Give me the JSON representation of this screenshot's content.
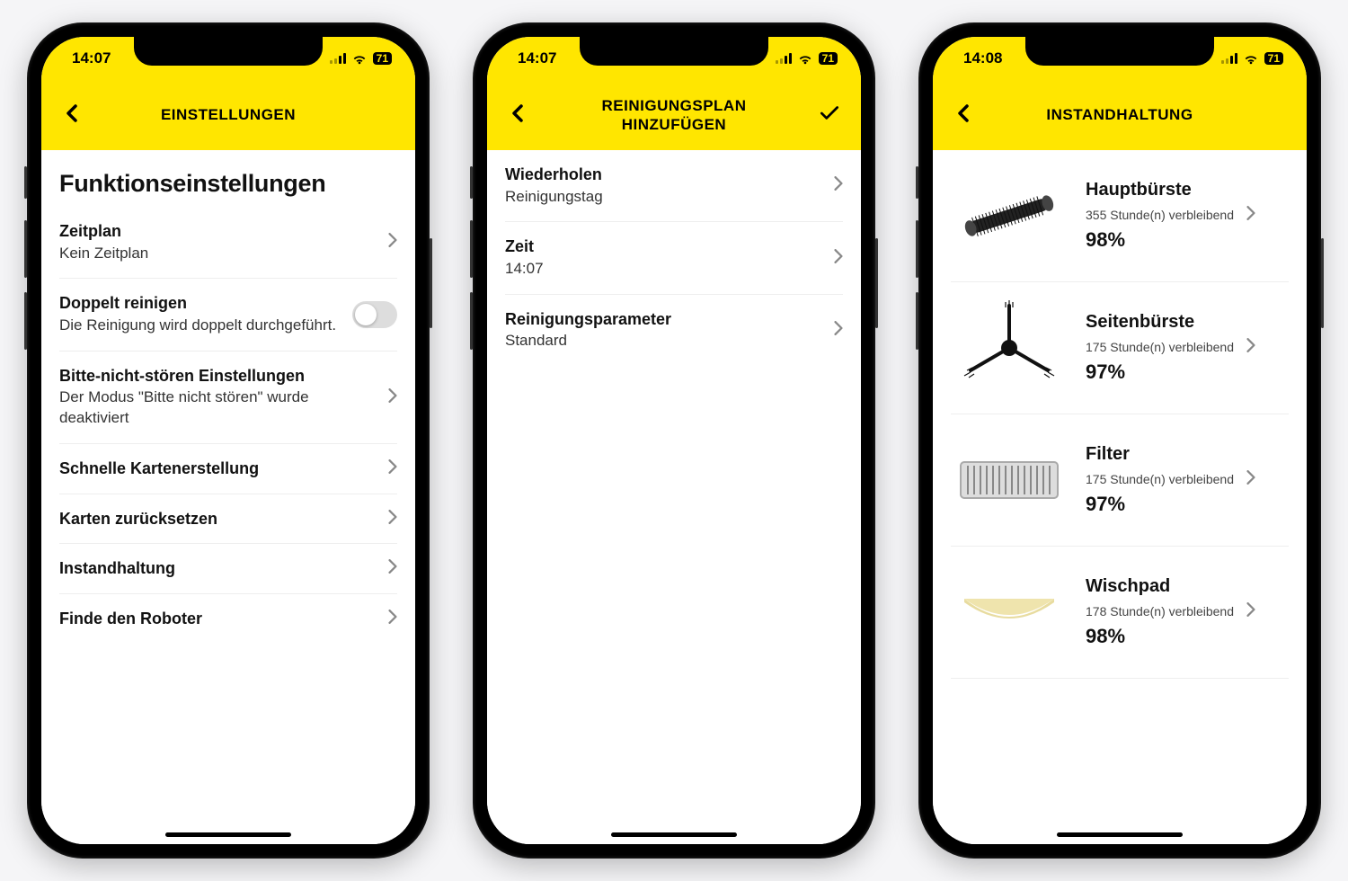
{
  "status": {
    "battery": "71"
  },
  "screens": [
    {
      "time": "14:07",
      "title": "EINSTELLUNGEN",
      "hasCheck": false,
      "sectionTitle": "Funktionseinstellungen",
      "rows": [
        {
          "type": "nav",
          "label": "Zeitplan",
          "sub": "Kein Zeitplan"
        },
        {
          "type": "toggle",
          "label": "Doppelt reinigen",
          "sub": "Die Reinigung wird doppelt durchgeführt.",
          "on": false
        },
        {
          "type": "nav",
          "label": "Bitte-nicht-stören Einstellungen",
          "sub": "Der Modus \"Bitte nicht stören\" wurde deaktiviert"
        },
        {
          "type": "nav",
          "label": "Schnelle Kartenerstellung"
        },
        {
          "type": "nav",
          "label": "Karten zurücksetzen"
        },
        {
          "type": "nav",
          "label": "Instandhaltung"
        },
        {
          "type": "nav",
          "label": "Finde den Roboter"
        }
      ]
    },
    {
      "time": "14:07",
      "title": "REINIGUNGSPLAN HINZUFÜGEN",
      "hasCheck": true,
      "rows": [
        {
          "type": "nav",
          "label": "Wiederholen",
          "sub": "Reinigungstag"
        },
        {
          "type": "nav",
          "label": "Zeit",
          "sub": "14:07"
        },
        {
          "type": "nav",
          "label": "Reinigungsparameter",
          "sub": "Standard"
        }
      ]
    },
    {
      "time": "14:08",
      "title": "INSTANDHALTUNG",
      "hasCheck": false,
      "maint": [
        {
          "icon": "main-brush",
          "name": "Hauptbürste",
          "hours": "355 Stunde(n) verbleibend",
          "pct": "98%"
        },
        {
          "icon": "side-brush",
          "name": "Seitenbürste",
          "hours": "175 Stunde(n) verbleibend",
          "pct": "97%"
        },
        {
          "icon": "filter",
          "name": "Filter",
          "hours": "175 Stunde(n) verbleibend",
          "pct": "97%"
        },
        {
          "icon": "mop-pad",
          "name": "Wischpad",
          "hours": "178 Stunde(n) verbleibend",
          "pct": "98%"
        }
      ]
    }
  ]
}
